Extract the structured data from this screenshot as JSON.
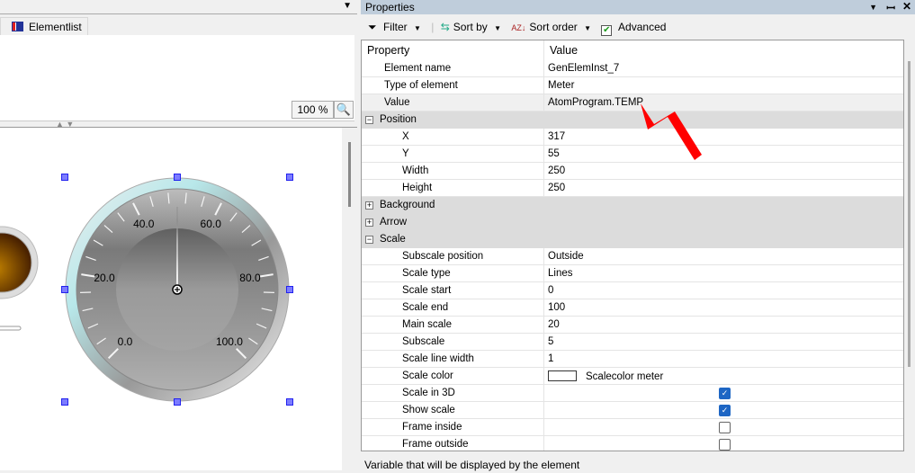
{
  "left_panel": {
    "tab_label": "Elementlist",
    "tab_icon": "table-list-icon",
    "zoom_value": "100 %",
    "zoom_icon": "zoom-fit-icon"
  },
  "meter": {
    "scale_start": 0,
    "scale_end": 100,
    "main_scale": 20,
    "subscale": 5,
    "labels": [
      "0.0",
      "20.0",
      "40.0",
      "60.0",
      "80.0",
      "100.0"
    ],
    "needle_value": 50
  },
  "properties": {
    "title": "Properties",
    "toolbar": {
      "filter": "Filter",
      "sort_by": "Sort by",
      "sort_order": "Sort order",
      "advanced": "Advanced",
      "advanced_checked": true
    },
    "columns": [
      "Property",
      "Value"
    ],
    "rows": [
      {
        "type": "prop",
        "level": 1,
        "name": "Element name",
        "value": "GenElemInst_7"
      },
      {
        "type": "prop",
        "level": 1,
        "name": "Type of element",
        "value": "Meter"
      },
      {
        "type": "prop",
        "level": 1,
        "name": "Value",
        "value": "AtomProgram.TEMP",
        "selected": true
      },
      {
        "type": "cat",
        "name": "Position",
        "expanded": true
      },
      {
        "type": "prop",
        "level": 2,
        "name": "X",
        "value": "317"
      },
      {
        "type": "prop",
        "level": 2,
        "name": "Y",
        "value": "55"
      },
      {
        "type": "prop",
        "level": 2,
        "name": "Width",
        "value": "250"
      },
      {
        "type": "prop",
        "level": 2,
        "name": "Height",
        "value": "250"
      },
      {
        "type": "cat",
        "name": "Background",
        "expanded": false
      },
      {
        "type": "cat",
        "name": "Arrow",
        "expanded": false
      },
      {
        "type": "cat",
        "name": "Scale",
        "expanded": true
      },
      {
        "type": "prop",
        "level": 2,
        "name": "Subscale position",
        "value": "Outside"
      },
      {
        "type": "prop",
        "level": 2,
        "name": "Scale type",
        "value": "Lines"
      },
      {
        "type": "prop",
        "level": 2,
        "name": "Scale start",
        "value": "0"
      },
      {
        "type": "prop",
        "level": 2,
        "name": "Scale end",
        "value": "100"
      },
      {
        "type": "prop",
        "level": 2,
        "name": "Main scale",
        "value": "20"
      },
      {
        "type": "prop",
        "level": 2,
        "name": "Subscale",
        "value": "5"
      },
      {
        "type": "prop",
        "level": 2,
        "name": "Scale line width",
        "value": "1"
      },
      {
        "type": "color",
        "level": 2,
        "name": "Scale color",
        "value": "Scalecolor meter",
        "swatch": "#ffffff"
      },
      {
        "type": "check",
        "level": 2,
        "name": "Scale in 3D",
        "checked": true
      },
      {
        "type": "check",
        "level": 2,
        "name": "Show scale",
        "checked": true
      },
      {
        "type": "check",
        "level": 2,
        "name": "Frame inside",
        "checked": false
      },
      {
        "type": "check",
        "level": 2,
        "name": "Frame outside",
        "checked": false
      }
    ],
    "status": "Variable that will be displayed by the element"
  },
  "colors": {
    "titlebar": "#bfcddb",
    "annotation_arrow": "#ff0000",
    "checkbox": "#1e66c4"
  }
}
